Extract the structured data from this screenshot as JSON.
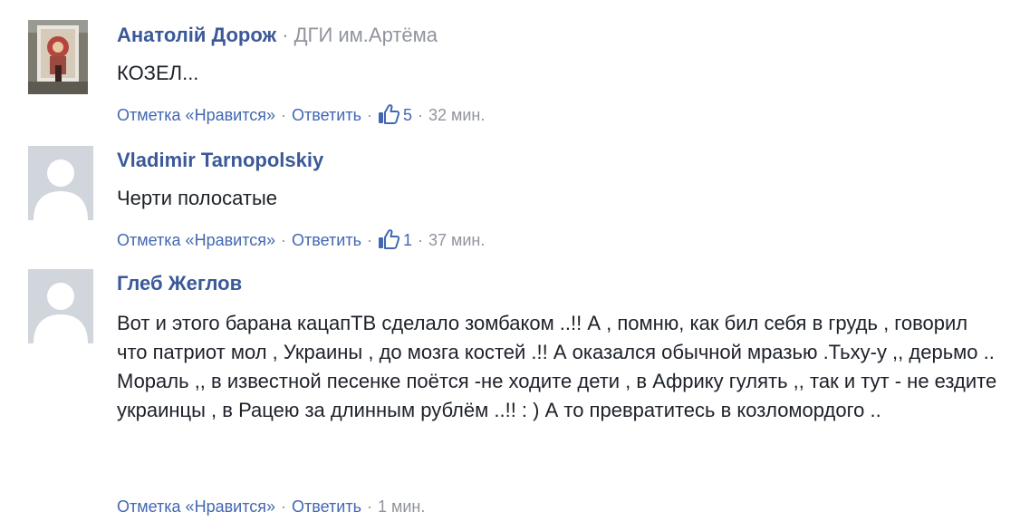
{
  "comments": [
    {
      "author": "Анатолій Дорож",
      "affiliation_separator": "·",
      "affiliation": "ДГИ им.Артёма",
      "avatar": "photo-avatar",
      "text": [
        "КОЗЕЛ..."
      ],
      "like_label": "Отметка «Нравится»",
      "reply_label": "Ответить",
      "separator": "·",
      "like_icon": "thumbs-up-icon",
      "likes": "5",
      "time": "32 мин."
    },
    {
      "author": "Vladimir Tarnopolskiy",
      "avatar": "default-silhouette-avatar",
      "text": [
        "Черти полосатые"
      ],
      "like_label": "Отметка «Нравится»",
      "reply_label": "Ответить",
      "separator": "·",
      "like_icon": "thumbs-up-icon",
      "likes": "1",
      "time": "37 мин."
    },
    {
      "author": "Глеб Жеглов",
      "avatar": "default-silhouette-avatar",
      "text": [
        "Вот и этого барана кацапТВ сделало зомбаком ..!! А , помню, как бил себя в грудь , говорил что патриот мол , Украины , до мозга костей .!! А оказался обычной мразью .Тьху-у ,, дерьмо ..",
        "Мораль ,, в известной песенке поётся -не ходите дети , в Африку гулять ,, так и тут - не ездите украинцы , в Рацею за длинным рублём ..!! : ) А то превратитесь в козломордого .."
      ],
      "like_label": "Отметка «Нравится»",
      "reply_label": "Ответить",
      "separator": "·",
      "time": "1 мин."
    }
  ],
  "colors": {
    "link": "#4267b2",
    "author": "#3b5998",
    "meta": "#90949c",
    "text": "#1d2129",
    "avatar_placeholder": "#d1d5dc"
  }
}
